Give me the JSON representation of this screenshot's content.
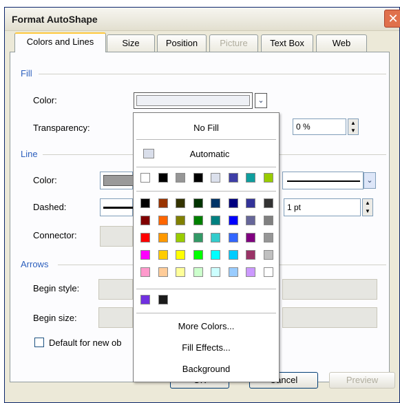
{
  "dialog": {
    "title": "Format AutoShape",
    "close_label": "✕"
  },
  "tabs": [
    {
      "label": "Colors and Lines",
      "state": "active"
    },
    {
      "label": "Size",
      "state": "normal"
    },
    {
      "label": "Position",
      "state": "normal"
    },
    {
      "label": "Picture",
      "state": "disabled"
    },
    {
      "label": "Text Box",
      "state": "normal"
    },
    {
      "label": "Web",
      "state": "normal"
    }
  ],
  "fill": {
    "section_title": "Fill",
    "color_label": "Color:",
    "transparency_label": "Transparency:",
    "transparency_value": "0 %"
  },
  "line": {
    "section_title": "Line",
    "color_label": "Color:",
    "dashed_label": "Dashed:",
    "connector_label": "Connector:",
    "weight_value": "1 pt"
  },
  "arrows": {
    "section_title": "Arrows",
    "begin_style_label": "Begin style:",
    "begin_size_label": "Begin size:"
  },
  "default_checkbox": {
    "label": "Default for new ob",
    "checked": false
  },
  "buttons": {
    "ok": "OK",
    "cancel": "Cancel",
    "preview": "Preview"
  },
  "color_popup": {
    "no_fill": "No Fill",
    "automatic": "Automatic",
    "automatic_swatch": "#d9deea",
    "more_colors": "More Colors...",
    "fill_effects": "Fill Effects...",
    "background": "Background",
    "scheme_row": [
      "#ffffff",
      "#000000",
      "#969696",
      "#000000",
      "#dbe0ec",
      "#3e3ea6",
      "#0f9e9e",
      "#99cc00"
    ],
    "palette": [
      [
        "#000000",
        "#993300",
        "#333300",
        "#003300",
        "#003366",
        "#000080",
        "#333399",
        "#333333"
      ],
      [
        "#800000",
        "#ff6600",
        "#808000",
        "#008000",
        "#008080",
        "#0000ff",
        "#666699",
        "#808080"
      ],
      [
        "#ff0000",
        "#ff9900",
        "#99cc00",
        "#339966",
        "#33cccc",
        "#3366ff",
        "#800080",
        "#969696"
      ],
      [
        "#ff00ff",
        "#ffcc00",
        "#ffff00",
        "#00ff00",
        "#00ffff",
        "#00ccff",
        "#993366",
        "#c0c0c0"
      ],
      [
        "#ff99cc",
        "#ffcc99",
        "#ffff99",
        "#ccffcc",
        "#ccffff",
        "#99ccff",
        "#cc99ff",
        "#ffffff"
      ]
    ],
    "recent": [
      "#7030e0",
      "#1a1a1a"
    ]
  }
}
